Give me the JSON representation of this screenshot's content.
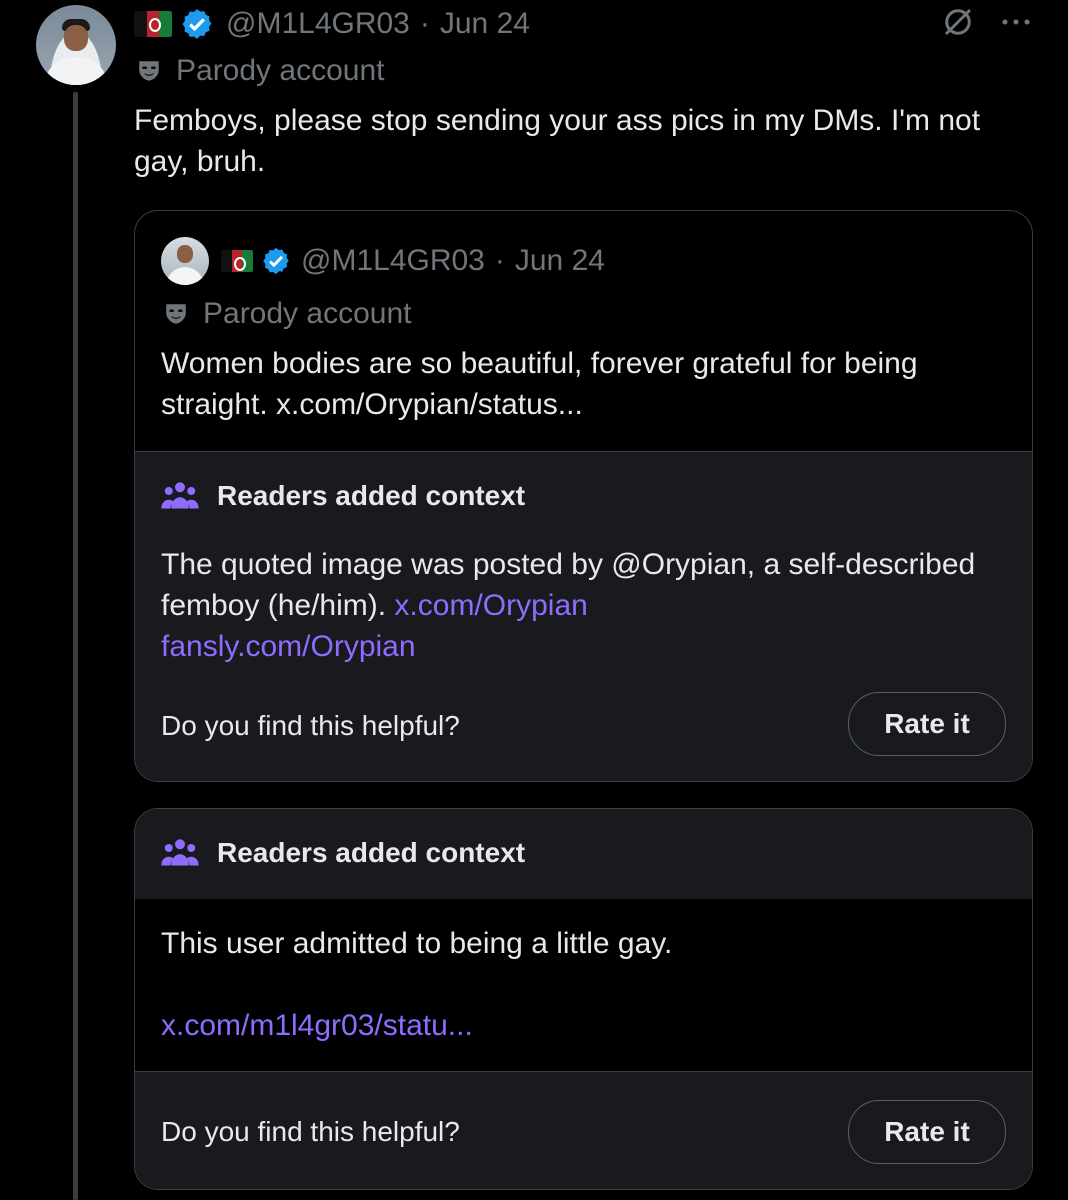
{
  "tweet": {
    "handle": "@M1L4GR03",
    "separator": "·",
    "date": "Jun 24",
    "parody_label": "Parody account",
    "text": "Femboys, please stop sending your ass pics in my DMs. I'm not gay, bruh."
  },
  "quote": {
    "handle": "@M1L4GR03",
    "separator": "·",
    "date": "Jun 24",
    "parody_label": "Parody account",
    "text": "Women bodies are so beautiful, forever grateful for being straight. x.com/Orypian/status..."
  },
  "context_a": {
    "title": "Readers added context",
    "body_text": "The quoted image was posted by @Orypian, a self-described femboy (he/him). ",
    "link_1": "x.com/Orypian",
    "link_2": "fansly.com/Orypian",
    "helpful_prompt": "Do you find this helpful?",
    "button": "Rate it"
  },
  "context_b": {
    "title": "Readers added context",
    "body_text": "This user admitted to being a little gay.",
    "link": "x.com/m1l4gr03/statu...",
    "helpful_prompt": "Do you find this helpful?",
    "button": "Rate it"
  },
  "icons": {
    "flag": "afghanistan-flag-icon",
    "verified": "verified-badge-icon",
    "parody": "parody-mask-icon",
    "grok": "grok-icon",
    "more": "more-options-icon",
    "community": "community-notes-icon"
  },
  "colors": {
    "background": "#000000",
    "text_primary": "#e7e9ea",
    "text_secondary": "#71767b",
    "link": "#8f6cff",
    "border": "#3a3d41",
    "card_bg": "#181a1d",
    "verified": "#1d9bf0"
  }
}
